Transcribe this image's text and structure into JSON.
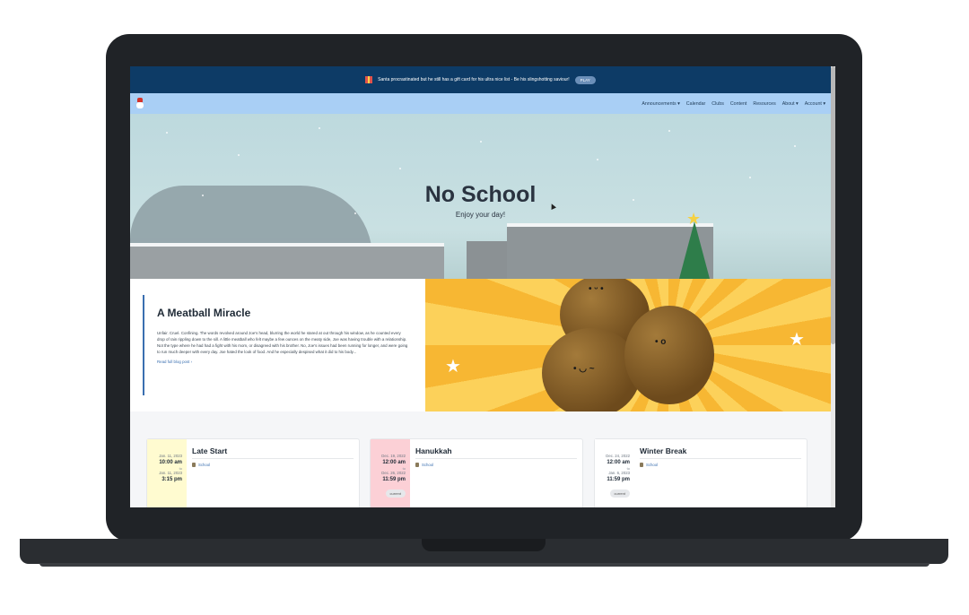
{
  "announcement": {
    "text": "Santa procrastinated but he still has a gift card for his ultra nice list - Be his slingshotting saviour!",
    "button": "PLAY"
  },
  "nav": {
    "items": [
      "Announcements ▾",
      "Calendar",
      "Clubs",
      "Content",
      "Resources",
      "About ▾",
      "Account ▾"
    ]
  },
  "hero": {
    "title": "No School",
    "subtitle": "Enjoy your day!"
  },
  "blog": {
    "title": "A Meatball Miracle",
    "body": "Unfair. Cruel. Confining. The words revolved around Joe's head, blurring the world he stared at out through his window, as he counted every drop of rain rippling down to the sill. A little meatball who felt maybe a few ounces on the meaty side, Joe was having trouble with a relationship. Not the type where he had had a fight with his mom, or disagreed with his brother. No, Joe's issues had been running for longer, and were going to run much deeper with every day. Joe hated the look of food. And he especially despised what it did to his body...",
    "link": "Read full blog post ›"
  },
  "events": [
    {
      "title": "Late Start",
      "start_date": "Jan. 11, 2023",
      "start_time": "10:00 am",
      "to": "to",
      "end_date": "Jan. 11, 2023",
      "end_time": "3:15 pm",
      "category": "School",
      "badge": "",
      "accent": "#fffbd0"
    },
    {
      "title": "Hanukkah",
      "start_date": "Dec. 19, 2022",
      "start_time": "12:00 am",
      "to": "to",
      "end_date": "Dec. 26, 2022",
      "end_time": "11:59 pm",
      "category": "School",
      "badge": "current",
      "accent": "#fcd0d6"
    },
    {
      "title": "Winter Break",
      "start_date": "Dec. 24, 2022",
      "start_time": "12:00 am",
      "to": "to",
      "end_date": "Jan. 6, 2023",
      "end_time": "11:59 pm",
      "category": "School",
      "badge": "current",
      "accent": "#ffffff"
    }
  ]
}
